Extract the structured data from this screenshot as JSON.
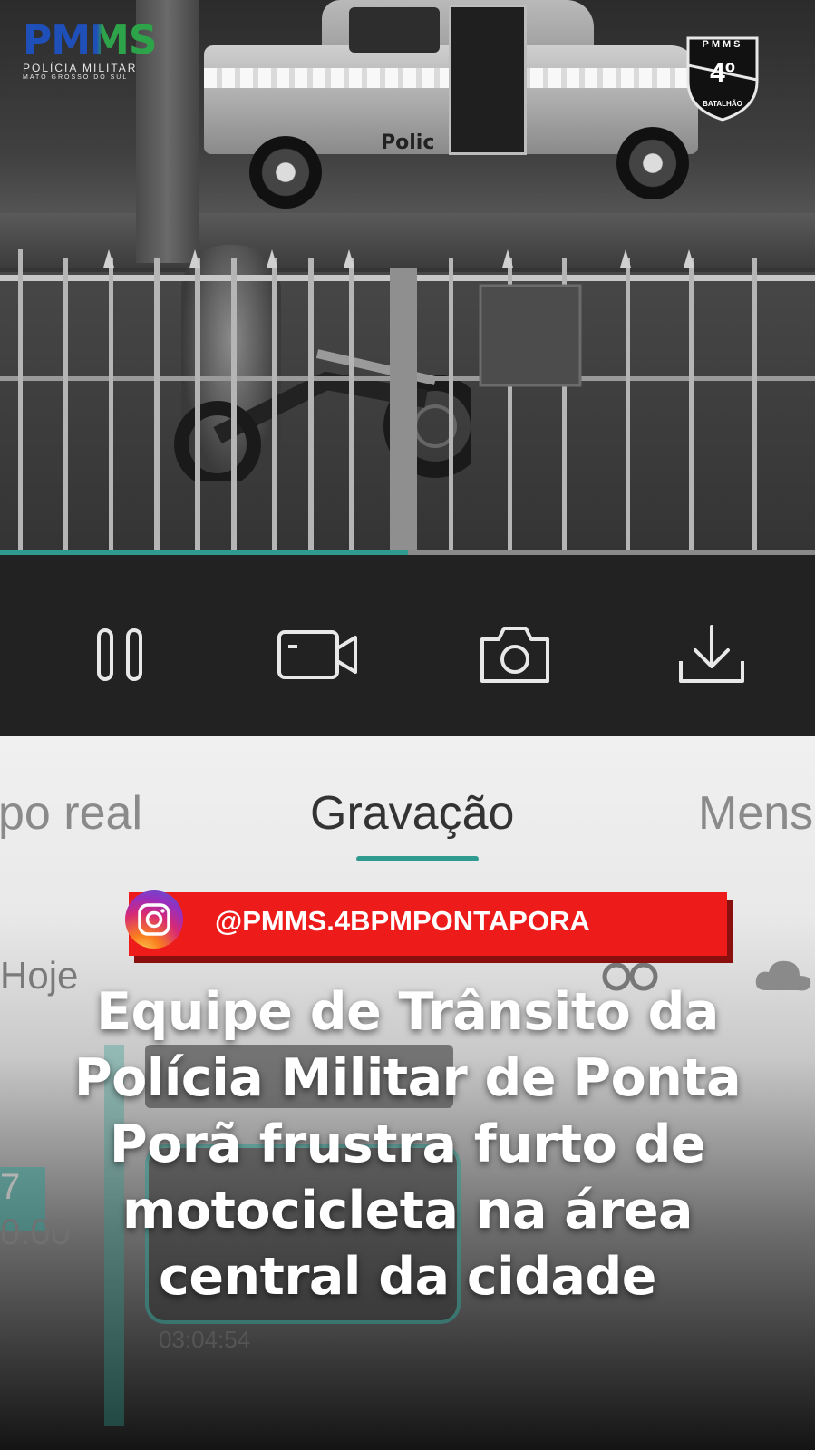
{
  "video": {
    "truck_label": "Polic",
    "logo_pmms": {
      "title": "PMMS",
      "subtitle": "POLÍCIA MILITAR",
      "subtitle2": "MATO GROSSO DO SUL",
      "colors": {
        "blue": "#1f4fb8",
        "green": "#2ea44a"
      }
    },
    "badge": {
      "top": "PMMS",
      "number": "4º",
      "bottom": "BATALHÃO"
    },
    "progress": 0.5
  },
  "controls": {
    "pause_icon": "pause-icon",
    "record_icon": "video-camera-icon",
    "snapshot_icon": "camera-icon",
    "download_icon": "download-icon"
  },
  "tabs": {
    "items": [
      {
        "label": "po real"
      },
      {
        "label": "Gravação",
        "active": true
      },
      {
        "label": "Mens"
      }
    ],
    "accent": "#2e9a90"
  },
  "background": {
    "day_label": "Hoje",
    "time1": "0.00",
    "time2": "03:04:54",
    "marker": "7"
  },
  "banner": {
    "instagram_handle": "@PMMS.4BPMPONTAPORA",
    "color": "#ee1b1b"
  },
  "headline": {
    "lines": [
      "Equipe de Trânsito da",
      "Polícia Militar de Ponta",
      "Porã frustra furto de",
      "motocicleta na área",
      "central da cidade"
    ]
  }
}
